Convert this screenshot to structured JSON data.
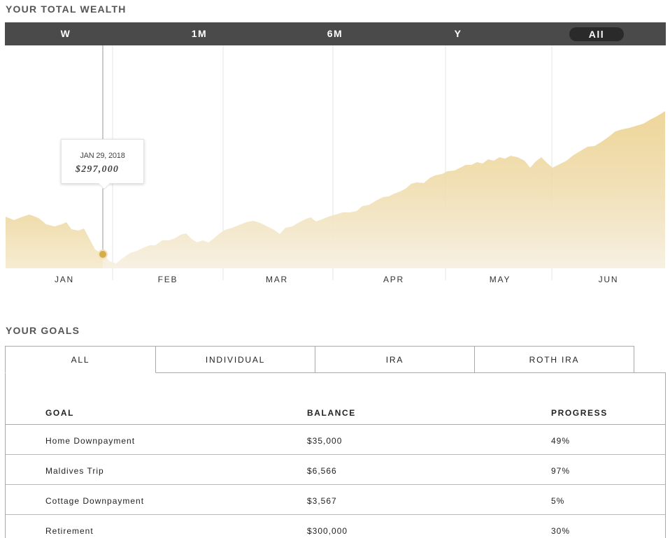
{
  "wealth": {
    "title": "YOUR TOTAL WEALTH",
    "ranges": [
      {
        "label": "W",
        "active": false
      },
      {
        "label": "1M",
        "active": false
      },
      {
        "label": "6M",
        "active": false
      },
      {
        "label": "Y",
        "active": false
      },
      {
        "label": "All",
        "active": true
      }
    ],
    "tooltip": {
      "date": "JAN 29, 2018",
      "value": "$297,000"
    }
  },
  "chart_data": {
    "type": "area",
    "title": "",
    "xlabel": "",
    "ylabel": "",
    "months": [
      "JAN",
      "FEB",
      "MAR",
      "APR",
      "MAY",
      "JUN"
    ],
    "fill_color_top": "#e8c97a",
    "fill_color_bottom": "#f7f1e4",
    "highlight_color": "#e3bf62",
    "selected_point": {
      "date": "JAN 29, 2018",
      "value": 297000
    }
  },
  "goals": {
    "title": "YOUR GOALS",
    "tabs": [
      {
        "label": "ALL",
        "active": true
      },
      {
        "label": "INDIVIDUAL",
        "active": false
      },
      {
        "label": "IRA",
        "active": false
      },
      {
        "label": "ROTH IRA",
        "active": false
      }
    ],
    "columns": {
      "goal": "GOAL",
      "balance": "BALANCE",
      "progress": "PROGRESS"
    },
    "rows": [
      {
        "goal": "Home Downpayment",
        "balance": "$35,000",
        "progress": "49%"
      },
      {
        "goal": "Maldives Trip",
        "balance": "$6,566",
        "progress": "97%"
      },
      {
        "goal": "Cottage Downpayment",
        "balance": "$3,567",
        "progress": "5%"
      },
      {
        "goal": "Retirement",
        "balance": "$300,000",
        "progress": "30%"
      }
    ]
  }
}
